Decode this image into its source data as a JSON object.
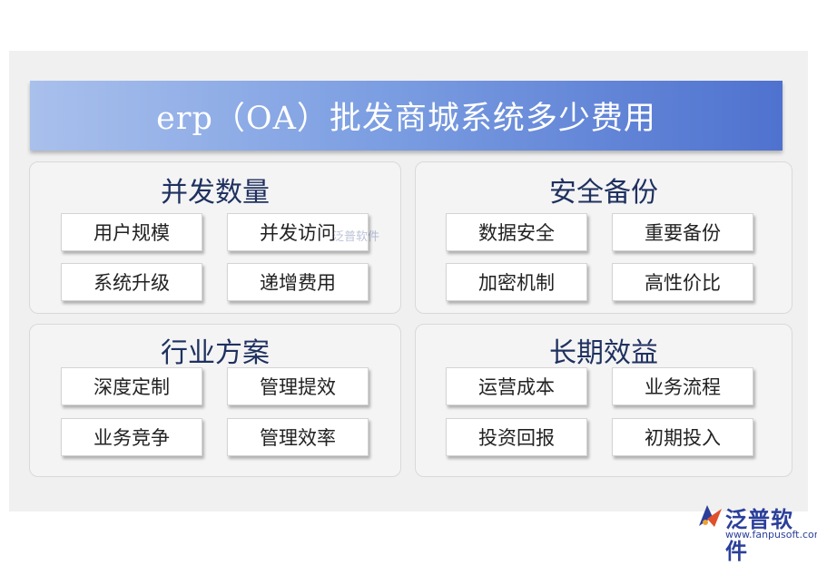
{
  "title": "erp（OA）批发商城系统多少费用",
  "panels": [
    {
      "title": "并发数量",
      "items": [
        "用户规模",
        "并发访问",
        "系统升级",
        "递增费用"
      ]
    },
    {
      "title": "安全备份",
      "items": [
        "数据安全",
        "重要备份",
        "加密机制",
        "高性价比"
      ]
    },
    {
      "title": "行业方案",
      "items": [
        "深度定制",
        "管理提效",
        "业务竞争",
        "管理效率"
      ]
    },
    {
      "title": "长期效益",
      "items": [
        "运营成本",
        "业务流程",
        "投资回报",
        "初期投入"
      ]
    }
  ],
  "watermark": "泛普软件",
  "logo": {
    "name": "泛普软件",
    "url": "www.fanpusoft.com"
  },
  "colors": {
    "banner_start": "#a9c0ec",
    "banner_end": "#4f72cf",
    "title_text": "#1f3160",
    "logo": "#2b3f9a"
  }
}
